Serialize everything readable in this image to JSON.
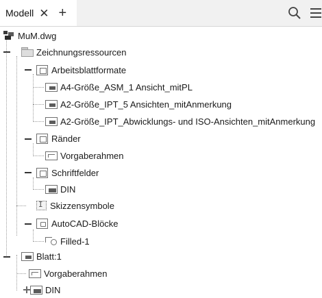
{
  "header": {
    "tab_label": "Modell",
    "close_glyph": "✕",
    "add_glyph": "+",
    "icons": [
      "close-icon",
      "plus-icon",
      "search-icon",
      "menu-icon"
    ]
  },
  "tree": {
    "root": "MuM.dwg",
    "resources": "Zeichnungsressourcen",
    "sheet_formats": "Arbeitsblattformate",
    "format_1": "A4-Größe_ASM_1 Ansicht_mitPL",
    "format_2": "A2-Größe_IPT_5 Ansichten_mitAnmerkung",
    "format_3": "A2-Größe_IPT_Abwicklungs- und ISO-Ansichten_mitAnmerkung",
    "borders": "Ränder",
    "default_border": "Vorgaberahmen",
    "title_blocks": "Schriftfelder",
    "title_block_din": "DIN",
    "sketch_symbols": "Skizzensymbole",
    "autocad_blocks": "AutoCAD-Blöcke",
    "block_filled": "Filled-1",
    "sheet": "Blatt:1",
    "sheet_border": "Vorgaberahmen",
    "sheet_din": "DIN"
  },
  "colors": {
    "tabbar_bg": "#f1f1f1",
    "tree_bg": "#ffffff",
    "text": "#1a1a1a",
    "connector": "#9a9a9a"
  }
}
